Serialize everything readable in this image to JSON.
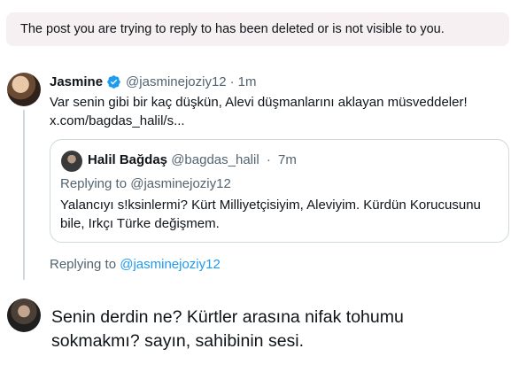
{
  "notice": {
    "text": "The post you are trying to reply to has been deleted or is not visible to you."
  },
  "post": {
    "author_name": "Jasmine",
    "author_handle": "@jasminejoziy12",
    "time": "1m",
    "text_line1": "Var senin gibi bir kaç düşkün, Alevi düşmanlarını aklayan müsveddeler!",
    "text_line2": "x.com/bagdas_halil/s..."
  },
  "quote": {
    "author_name": "Halil Bağdaş",
    "author_handle": "@bagdas_halil",
    "time": "7m",
    "replying": "Replying to @jasminejoziy12",
    "text_line1": "Yalancıyı s!ksinlermi? Kürt Milliyetçisiyim, Aleviyim. Kürdün Korucusunu",
    "text_line2": "bile, Irkçı Türke değişmem."
  },
  "replying": {
    "prefix": "Replying to",
    "mention": "@jasminejoziy12"
  },
  "compose": {
    "line1": "Senin derdin ne? Kürtler arasına nifak tohumu",
    "line2": "sokmakmı? sayın, sahibinin sesi."
  },
  "icons": {
    "verified": "verified-badge-icon"
  },
  "colors": {
    "accent": "#1d9bf0",
    "muted": "#536471",
    "notice_bg": "#f7f0f2"
  }
}
